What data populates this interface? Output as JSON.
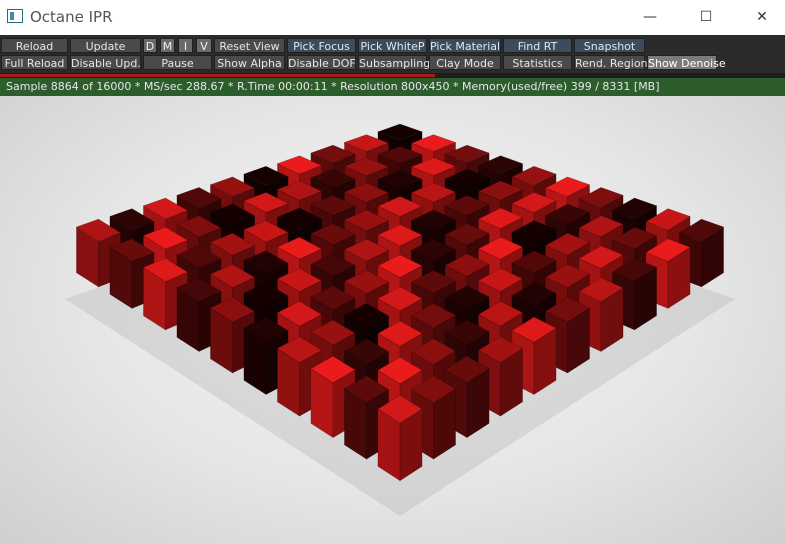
{
  "window": {
    "title": "Octane IPR",
    "minimize_glyph": "—",
    "maximize_glyph": "☐",
    "close_glyph": "✕"
  },
  "toolbar": {
    "row1": [
      {
        "label": "Reload",
        "style": "normal"
      },
      {
        "label": "Update",
        "style": "normal"
      },
      {
        "label": "D",
        "style": "small"
      },
      {
        "label": "M",
        "style": "small"
      },
      {
        "label": "I",
        "style": "small"
      },
      {
        "label": "V",
        "style": "small"
      },
      {
        "label": "Reset View",
        "style": "normal"
      },
      {
        "label": "Pick Focus",
        "style": "blue"
      },
      {
        "label": "Pick WhiteP",
        "style": "blue"
      },
      {
        "label": "Pick Material",
        "style": "blue"
      },
      {
        "label": "Find RT",
        "style": "blue"
      },
      {
        "label": "Snapshot",
        "style": "blue"
      }
    ],
    "row2": [
      {
        "label": "Full Reload",
        "style": "normal"
      },
      {
        "label": "Disable Upd.",
        "style": "normal"
      },
      {
        "label": "Pause",
        "style": "normal"
      },
      {
        "label": "Show Alpha",
        "style": "normal"
      },
      {
        "label": "Disable DOF",
        "style": "normal"
      },
      {
        "label": "Subsampling",
        "style": "normal"
      },
      {
        "label": "Clay Mode",
        "style": "normal"
      },
      {
        "label": "Statistics",
        "style": "normal"
      },
      {
        "label": "Rend. Region",
        "style": "normal"
      },
      {
        "label": "Show Denoise",
        "style": "active"
      }
    ]
  },
  "render": {
    "progress_fraction": 0.554,
    "status_text": "Sample 8864 of 16000 * MS/sec 288.67 * R.Time 00:00:11 * Resolution 800x450 * Memory(used/free) 399 / 8331 [MB]"
  },
  "scene": {
    "grid_size": 10,
    "cube_shades": [
      [
        0.05,
        0.95,
        0.45,
        0.15,
        0.6,
        0.95,
        0.5,
        0.1,
        0.8,
        0.3
      ],
      [
        0.8,
        0.3,
        0.9,
        0.05,
        0.55,
        0.85,
        0.2,
        0.7,
        0.4,
        0.95
      ],
      [
        0.45,
        0.6,
        0.1,
        0.75,
        0.35,
        0.9,
        0.05,
        0.65,
        0.85,
        0.25
      ],
      [
        0.95,
        0.2,
        0.55,
        0.85,
        0.1,
        0.4,
        0.95,
        0.3,
        0.6,
        0.75
      ],
      [
        0.05,
        0.7,
        0.35,
        0.6,
        0.9,
        0.15,
        0.55,
        0.8,
        0.1,
        0.45
      ],
      [
        0.6,
        0.85,
        0.05,
        0.4,
        0.7,
        0.95,
        0.35,
        0.1,
        0.75,
        0.9
      ],
      [
        0.3,
        0.05,
        0.8,
        0.95,
        0.25,
        0.6,
        0.85,
        0.45,
        0.2,
        0.65
      ],
      [
        0.85,
        0.5,
        0.65,
        0.1,
        0.8,
        0.35,
        0.05,
        0.9,
        0.55,
        0.4
      ],
      [
        0.15,
        0.95,
        0.3,
        0.7,
        0.05,
        0.85,
        0.6,
        0.2,
        0.95,
        0.5
      ],
      [
        0.7,
        0.4,
        0.9,
        0.25,
        0.55,
        0.1,
        0.75,
        0.95,
        0.35,
        0.85
      ]
    ],
    "colors": {
      "bright_red": "#ff1c1c",
      "dark": "#0a0000"
    }
  }
}
